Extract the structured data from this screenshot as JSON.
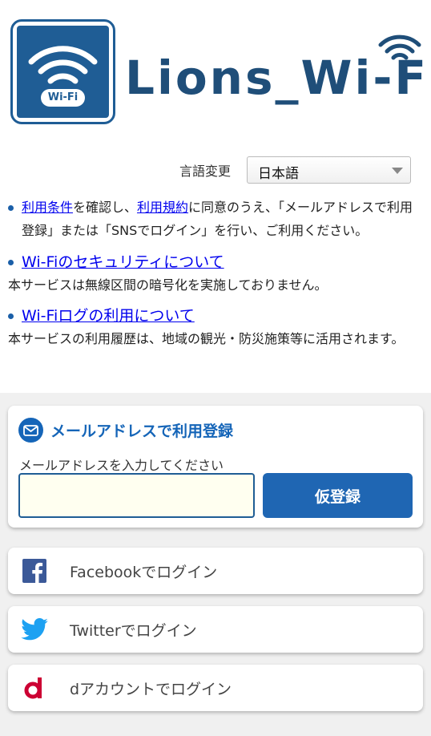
{
  "header": {
    "logo_badge": "Wi-Fi",
    "brand": "Lions_Wi-Fi"
  },
  "language": {
    "label": "言語変更",
    "selected": "日本語"
  },
  "notices": [
    {
      "link1": "利用条件",
      "text1": "を確認し、",
      "link2": "利用規約",
      "text2": "に同意のうえ、「メールアドレスで利用登録」または「SNSでログイン」を行い、ご利用ください。"
    },
    {
      "link": "Wi-Fiのセキュリティについて",
      "body": "本サービスは無線区間の暗号化を実施しておりません。"
    },
    {
      "link": "Wi-Fiログの利用について",
      "body": "本サービスの利用履歴は、地域の観光・防災施策等に活用されます。"
    }
  ],
  "register": {
    "title": "メールアドレスで利用登録",
    "label": "メールアドレスを入力してください",
    "email_value": "",
    "button": "仮登録"
  },
  "logins": {
    "facebook": "Facebookでログイン",
    "twitter": "Twitterでログイン",
    "docomo": "dアカウントでログイン"
  },
  "colors": {
    "brand_blue": "#1f5d95",
    "button_blue": "#1f66b3",
    "facebook": "#3b5998",
    "twitter": "#1da1f2",
    "docomo": "#cc0033"
  }
}
